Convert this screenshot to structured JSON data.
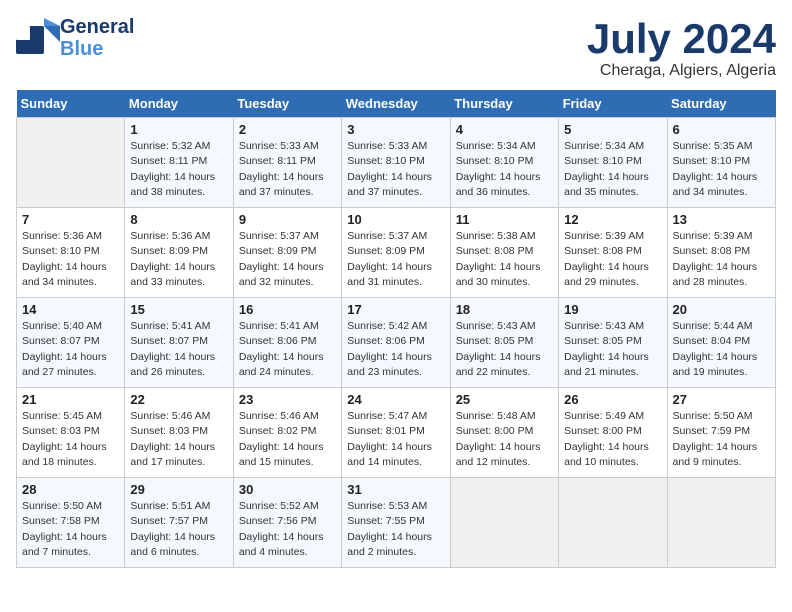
{
  "header": {
    "logo_general": "General",
    "logo_blue": "Blue",
    "month": "July 2024",
    "location": "Cheraga, Algiers, Algeria"
  },
  "weekdays": [
    "Sunday",
    "Monday",
    "Tuesday",
    "Wednesday",
    "Thursday",
    "Friday",
    "Saturday"
  ],
  "weeks": [
    [
      {
        "day": "",
        "sunrise": "",
        "sunset": "",
        "daylight": ""
      },
      {
        "day": "1",
        "sunrise": "Sunrise: 5:32 AM",
        "sunset": "Sunset: 8:11 PM",
        "daylight": "Daylight: 14 hours and 38 minutes."
      },
      {
        "day": "2",
        "sunrise": "Sunrise: 5:33 AM",
        "sunset": "Sunset: 8:11 PM",
        "daylight": "Daylight: 14 hours and 37 minutes."
      },
      {
        "day": "3",
        "sunrise": "Sunrise: 5:33 AM",
        "sunset": "Sunset: 8:10 PM",
        "daylight": "Daylight: 14 hours and 37 minutes."
      },
      {
        "day": "4",
        "sunrise": "Sunrise: 5:34 AM",
        "sunset": "Sunset: 8:10 PM",
        "daylight": "Daylight: 14 hours and 36 minutes."
      },
      {
        "day": "5",
        "sunrise": "Sunrise: 5:34 AM",
        "sunset": "Sunset: 8:10 PM",
        "daylight": "Daylight: 14 hours and 35 minutes."
      },
      {
        "day": "6",
        "sunrise": "Sunrise: 5:35 AM",
        "sunset": "Sunset: 8:10 PM",
        "daylight": "Daylight: 14 hours and 34 minutes."
      }
    ],
    [
      {
        "day": "7",
        "sunrise": "Sunrise: 5:36 AM",
        "sunset": "Sunset: 8:10 PM",
        "daylight": "Daylight: 14 hours and 34 minutes."
      },
      {
        "day": "8",
        "sunrise": "Sunrise: 5:36 AM",
        "sunset": "Sunset: 8:09 PM",
        "daylight": "Daylight: 14 hours and 33 minutes."
      },
      {
        "day": "9",
        "sunrise": "Sunrise: 5:37 AM",
        "sunset": "Sunset: 8:09 PM",
        "daylight": "Daylight: 14 hours and 32 minutes."
      },
      {
        "day": "10",
        "sunrise": "Sunrise: 5:37 AM",
        "sunset": "Sunset: 8:09 PM",
        "daylight": "Daylight: 14 hours and 31 minutes."
      },
      {
        "day": "11",
        "sunrise": "Sunrise: 5:38 AM",
        "sunset": "Sunset: 8:08 PM",
        "daylight": "Daylight: 14 hours and 30 minutes."
      },
      {
        "day": "12",
        "sunrise": "Sunrise: 5:39 AM",
        "sunset": "Sunset: 8:08 PM",
        "daylight": "Daylight: 14 hours and 29 minutes."
      },
      {
        "day": "13",
        "sunrise": "Sunrise: 5:39 AM",
        "sunset": "Sunset: 8:08 PM",
        "daylight": "Daylight: 14 hours and 28 minutes."
      }
    ],
    [
      {
        "day": "14",
        "sunrise": "Sunrise: 5:40 AM",
        "sunset": "Sunset: 8:07 PM",
        "daylight": "Daylight: 14 hours and 27 minutes."
      },
      {
        "day": "15",
        "sunrise": "Sunrise: 5:41 AM",
        "sunset": "Sunset: 8:07 PM",
        "daylight": "Daylight: 14 hours and 26 minutes."
      },
      {
        "day": "16",
        "sunrise": "Sunrise: 5:41 AM",
        "sunset": "Sunset: 8:06 PM",
        "daylight": "Daylight: 14 hours and 24 minutes."
      },
      {
        "day": "17",
        "sunrise": "Sunrise: 5:42 AM",
        "sunset": "Sunset: 8:06 PM",
        "daylight": "Daylight: 14 hours and 23 minutes."
      },
      {
        "day": "18",
        "sunrise": "Sunrise: 5:43 AM",
        "sunset": "Sunset: 8:05 PM",
        "daylight": "Daylight: 14 hours and 22 minutes."
      },
      {
        "day": "19",
        "sunrise": "Sunrise: 5:43 AM",
        "sunset": "Sunset: 8:05 PM",
        "daylight": "Daylight: 14 hours and 21 minutes."
      },
      {
        "day": "20",
        "sunrise": "Sunrise: 5:44 AM",
        "sunset": "Sunset: 8:04 PM",
        "daylight": "Daylight: 14 hours and 19 minutes."
      }
    ],
    [
      {
        "day": "21",
        "sunrise": "Sunrise: 5:45 AM",
        "sunset": "Sunset: 8:03 PM",
        "daylight": "Daylight: 14 hours and 18 minutes."
      },
      {
        "day": "22",
        "sunrise": "Sunrise: 5:46 AM",
        "sunset": "Sunset: 8:03 PM",
        "daylight": "Daylight: 14 hours and 17 minutes."
      },
      {
        "day": "23",
        "sunrise": "Sunrise: 5:46 AM",
        "sunset": "Sunset: 8:02 PM",
        "daylight": "Daylight: 14 hours and 15 minutes."
      },
      {
        "day": "24",
        "sunrise": "Sunrise: 5:47 AM",
        "sunset": "Sunset: 8:01 PM",
        "daylight": "Daylight: 14 hours and 14 minutes."
      },
      {
        "day": "25",
        "sunrise": "Sunrise: 5:48 AM",
        "sunset": "Sunset: 8:00 PM",
        "daylight": "Daylight: 14 hours and 12 minutes."
      },
      {
        "day": "26",
        "sunrise": "Sunrise: 5:49 AM",
        "sunset": "Sunset: 8:00 PM",
        "daylight": "Daylight: 14 hours and 10 minutes."
      },
      {
        "day": "27",
        "sunrise": "Sunrise: 5:50 AM",
        "sunset": "Sunset: 7:59 PM",
        "daylight": "Daylight: 14 hours and 9 minutes."
      }
    ],
    [
      {
        "day": "28",
        "sunrise": "Sunrise: 5:50 AM",
        "sunset": "Sunset: 7:58 PM",
        "daylight": "Daylight: 14 hours and 7 minutes."
      },
      {
        "day": "29",
        "sunrise": "Sunrise: 5:51 AM",
        "sunset": "Sunset: 7:57 PM",
        "daylight": "Daylight: 14 hours and 6 minutes."
      },
      {
        "day": "30",
        "sunrise": "Sunrise: 5:52 AM",
        "sunset": "Sunset: 7:56 PM",
        "daylight": "Daylight: 14 hours and 4 minutes."
      },
      {
        "day": "31",
        "sunrise": "Sunrise: 5:53 AM",
        "sunset": "Sunset: 7:55 PM",
        "daylight": "Daylight: 14 hours and 2 minutes."
      },
      {
        "day": "",
        "sunrise": "",
        "sunset": "",
        "daylight": ""
      },
      {
        "day": "",
        "sunrise": "",
        "sunset": "",
        "daylight": ""
      },
      {
        "day": "",
        "sunrise": "",
        "sunset": "",
        "daylight": ""
      }
    ]
  ]
}
